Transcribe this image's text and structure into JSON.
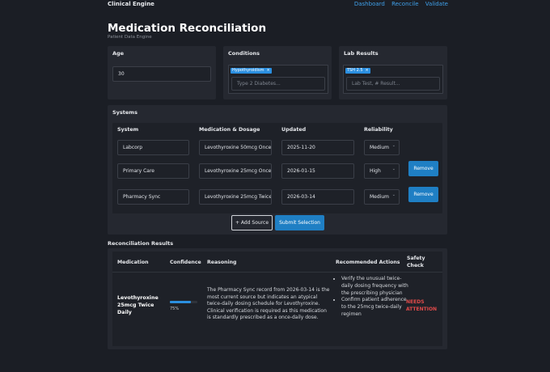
{
  "header": {
    "brand": "Clinical Engine",
    "nav": [
      "Dashboard",
      "Reconcile",
      "Validate"
    ]
  },
  "page": {
    "title": "Medication Reconciliation",
    "subtitle": "Patient Data Engine"
  },
  "age": {
    "label": "Age",
    "value": "30"
  },
  "conditions": {
    "label": "Conditions",
    "chips": [
      "Hypothyroidism"
    ],
    "placeholder": "Type 2 Diabetes..."
  },
  "labs": {
    "label": "Lab Results",
    "chips": [
      "TSH 2.5"
    ],
    "placeholder": "Lab Test, # Result..."
  },
  "systems": {
    "label": "Systems",
    "headers": [
      "System",
      "Medication & Dosage",
      "Updated",
      "Reliability"
    ],
    "rows": [
      {
        "system": "Labcorp",
        "medication": "Levothyroxine 50mcg Once",
        "updated": "2025-11-20",
        "reliability": "Medium",
        "remove": ""
      },
      {
        "system": "Primary Care",
        "medication": "Levothyroxine 25mcg Once",
        "updated": "2026-01-15",
        "reliability": "High",
        "remove": "Remove"
      },
      {
        "system": "Pharmacy Sync",
        "medication": "Levothyroxine 25mcg Twice",
        "updated": "2026-03-14",
        "reliability": "Medium",
        "remove": "Remove"
      }
    ],
    "add_label": "+ Add Source",
    "submit_label": "Submit Selection"
  },
  "results": {
    "label": "Reconciliation Results",
    "headers": {
      "medication": "Medication",
      "confidence": "Confidence",
      "reasoning": "Reasoning",
      "actions": "Recommended Actions",
      "safety_1": "Safety",
      "safety_2": "Check"
    },
    "row": {
      "medication_1": "Levothyroxine",
      "medication_2": "25mcg Twice",
      "medication_3": "Daily",
      "confidence_value": 75,
      "confidence_text": "75%",
      "reasoning": "The Pharmacy Sync record from 2026-03-14 is the most current source but indicates an atypical twice-daily dosing schedule for Levothyroxine. Clinical verification is required as this medication is standardly prescribed as a once-daily dose.",
      "actions": [
        "Verify the unusual twice-daily dosing frequency with the prescribing physician",
        "Confirm patient adherence to the 25mcg twice-daily regimen"
      ],
      "safety_1": "NEEDS",
      "safety_2": "ATTENTION"
    }
  },
  "colors": {
    "background": "#1b1e25",
    "panel": "#252830",
    "accent": "#2b8fe0",
    "button": "#1f7fc4",
    "danger": "#e04a4a"
  }
}
